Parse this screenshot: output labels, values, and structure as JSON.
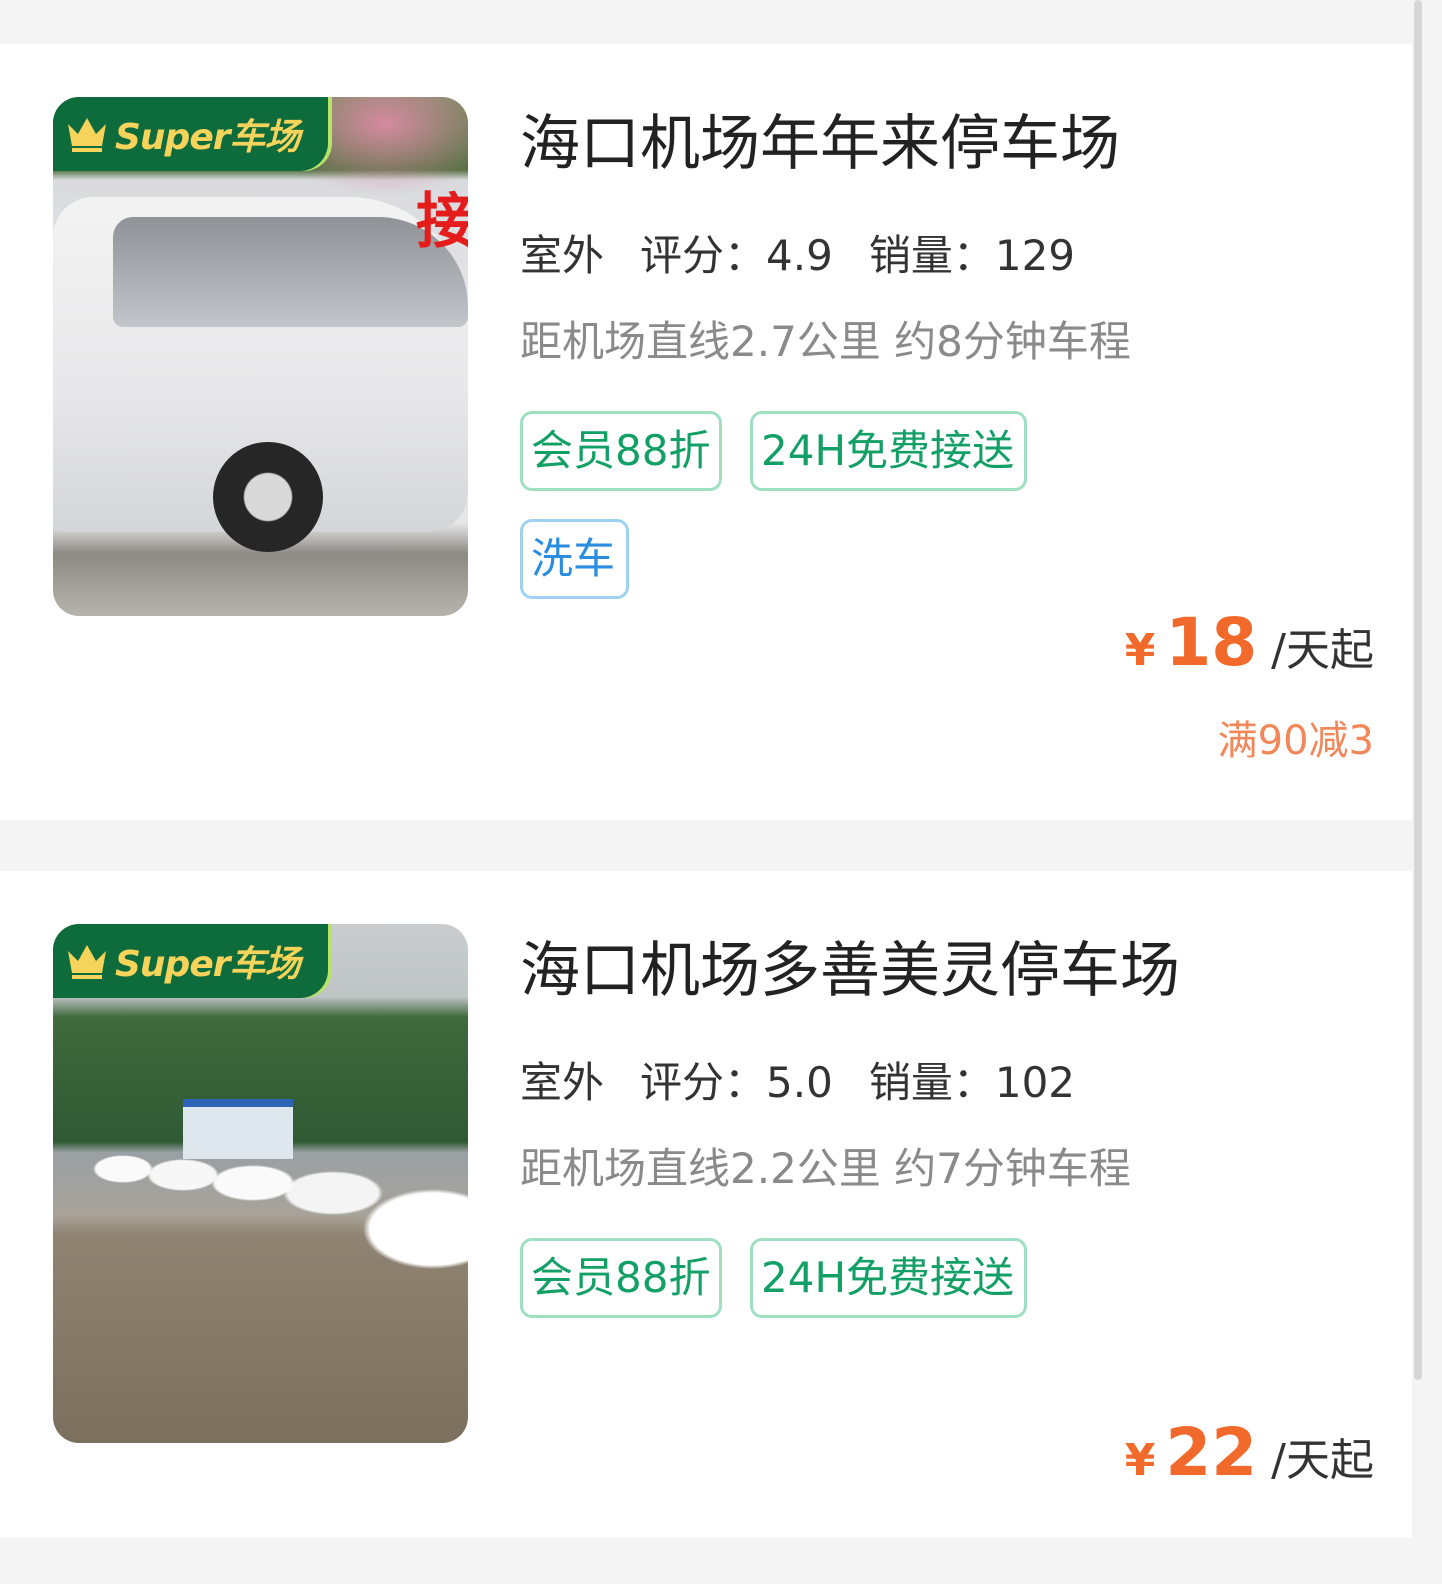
{
  "lots": [
    {
      "badge": "Super车场",
      "image_icon": "van-photo",
      "image_sign": "接",
      "title": "海口机场年年来停车场",
      "type_label": "室外",
      "rating_label": "评分：",
      "rating": "4.9",
      "sales_label": "销量：",
      "sales": "129",
      "distance": "距机场直线2.7公里 约8分钟车程",
      "tags": [
        "会员88折",
        "24H免费接送"
      ],
      "extra_tags": [
        "洗车"
      ],
      "currency": "¥",
      "price": "18",
      "unit": "/天起",
      "promo": "满90减3"
    },
    {
      "badge": "Super车场",
      "image_icon": "parking-lot-photo",
      "title": "海口机场多善美灵停车场",
      "type_label": "室外",
      "rating_label": "评分：",
      "rating": "5.0",
      "sales_label": "销量：",
      "sales": "102",
      "distance": "距机场直线2.2公里 约7分钟车程",
      "tags": [
        "会员88折",
        "24H免费接送"
      ],
      "currency": "¥",
      "price": "22",
      "unit": "/天起"
    }
  ],
  "colors": {
    "accent_price": "#f26a2b",
    "tag_green": "#13a066",
    "tag_blue": "#2b8de0",
    "badge_bg": "#0e6b3b",
    "badge_text": "#f6d35a"
  }
}
